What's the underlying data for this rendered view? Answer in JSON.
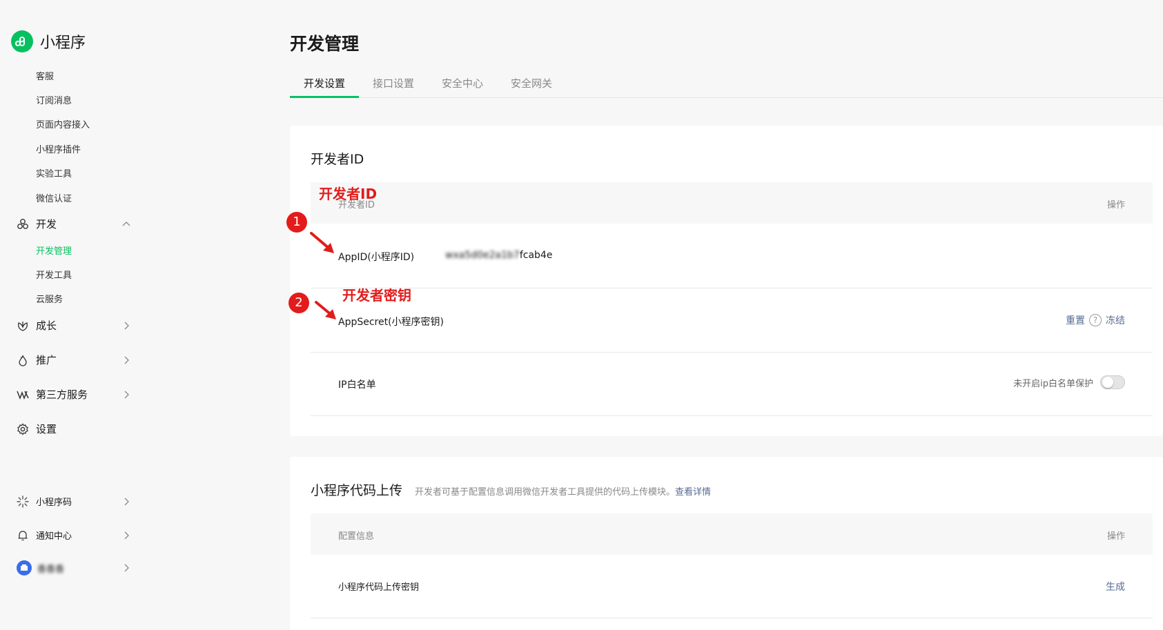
{
  "brand": {
    "title": "小程序",
    "logo_icon": "miniprogram-logo-icon",
    "color": "#07c160"
  },
  "sidebar": {
    "top_subitems": [
      "客服",
      "订阅消息",
      "页面内容接入",
      "小程序插件",
      "实验工具",
      "微信认证"
    ],
    "dev_group": {
      "label": "开发",
      "icon": "dev-icon"
    },
    "dev_subitems": [
      "开发管理",
      "开发工具",
      "云服务"
    ],
    "active_subitem": "开发管理",
    "groups": [
      {
        "label": "成长",
        "icon": "growth-icon"
      },
      {
        "label": "推广",
        "icon": "promotion-icon"
      },
      {
        "label": "第三方服务",
        "icon": "third-party-icon"
      },
      {
        "label": "设置",
        "icon": "gear-icon"
      }
    ],
    "bottom": [
      {
        "label": "小程序码",
        "icon": "qrcode-icon"
      },
      {
        "label": "通知中心",
        "icon": "bell-icon"
      },
      {
        "label": "香香香",
        "icon": "avatar"
      }
    ]
  },
  "main": {
    "title": "开发管理",
    "tabs": [
      "开发设置",
      "接口设置",
      "安全中心",
      "安全网关"
    ],
    "active_tab": "开发设置",
    "dev_id_card": {
      "title": "开发者ID",
      "header_left": "开发者ID",
      "header_right": "操作",
      "appid_label": "AppID(小程序ID)",
      "appid_value": "wxa5d0e2a1b7fcab4e",
      "secret_label": "AppSecret(小程序密钥)",
      "reset_label": "重置",
      "help_icon": "?",
      "freeze_label": "冻结",
      "ip_label": "IP白名单",
      "ip_status": "未开启ip白名单保护"
    },
    "upload_card": {
      "title": "小程序代码上传",
      "desc": "开发者可基于配置信息调用微信开发者工具提供的代码上传模块。",
      "desc_link": "查看详情",
      "header_left": "配置信息",
      "header_right": "操作",
      "row_label": "小程序代码上传密钥",
      "row_action": "生成"
    }
  },
  "annotations": {
    "label1": "开发者ID",
    "label2": "开发者密钥",
    "badge1": "1",
    "badge2": "2",
    "color": "#e31b1b"
  }
}
